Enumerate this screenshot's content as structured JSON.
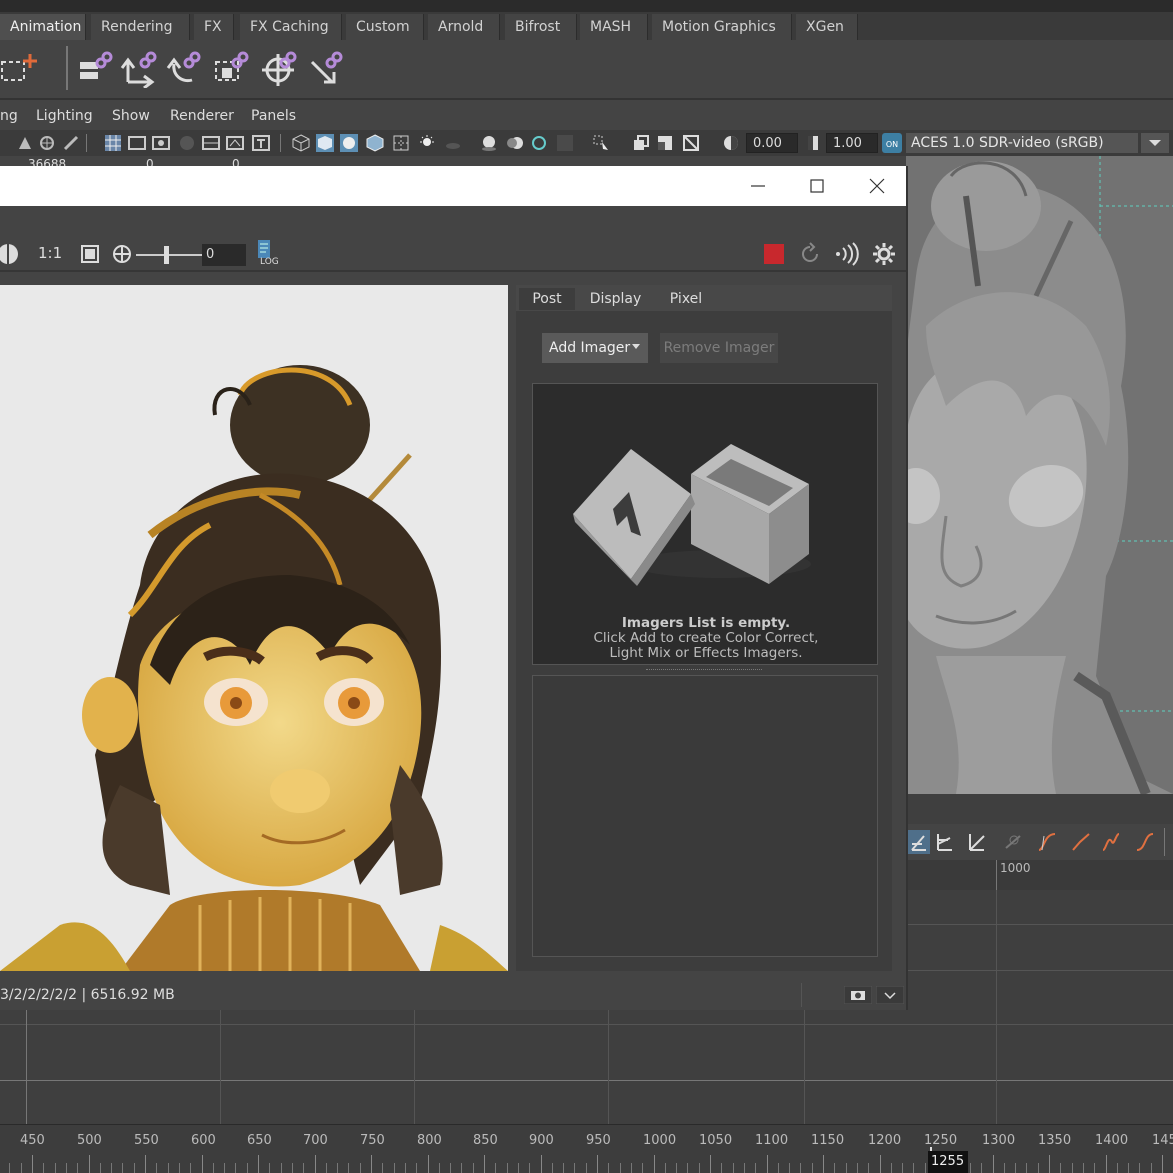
{
  "shelf": {
    "tabs": [
      "Animation",
      "Rendering",
      "FX",
      "FX Caching",
      "Custom",
      "Arnold",
      "Bifrost",
      "MASH",
      "Motion Graphics",
      "XGen"
    ]
  },
  "panel_menu": [
    "ng",
    "Lighting",
    "Show",
    "Renderer",
    "Panels"
  ],
  "panel_toolbar": {
    "exposure": "0.00",
    "gamma": "1.00",
    "color_space": "ACES 1.0 SDR-video (sRGB)"
  },
  "hud": {
    "values": [
      "36688",
      "0",
      "0"
    ]
  },
  "render_view": {
    "zoom_label": "1:1",
    "exposure_value": "0",
    "log_label": "LOG",
    "tabs": [
      "Post",
      "Display",
      "Pixel"
    ],
    "add_imager_label": "Add Imager",
    "remove_imager_label": "Remove Imager",
    "empty_title": "Imagers List is empty.",
    "empty_line1": "Click Add to create Color Correct,",
    "empty_line2": "Light Mix or Effects Imagers.",
    "status": "3/2/2/2/2/2 | 6516.92 MB",
    "accent_stop": "#c8282d"
  },
  "graph_editor": {
    "ruler_label": "1000"
  },
  "time_slider": {
    "labels": [
      "450",
      "500",
      "550",
      "600",
      "650",
      "700",
      "750",
      "800",
      "850",
      "900",
      "950",
      "1000",
      "1050",
      "1100",
      "1150",
      "1200",
      "1250",
      "1300",
      "1350",
      "1400",
      "145"
    ],
    "current_frame": "1255"
  }
}
